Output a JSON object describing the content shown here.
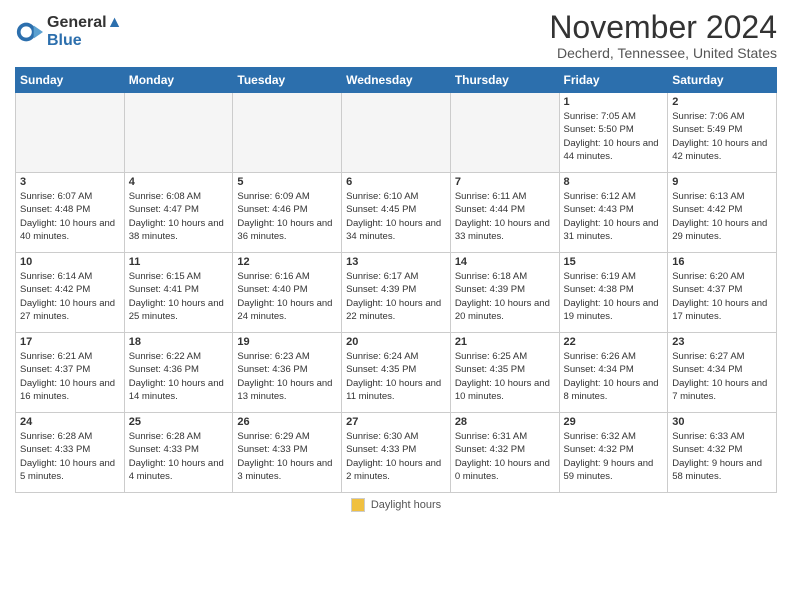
{
  "header": {
    "logo_line1": "General",
    "logo_line2": "Blue",
    "month": "November 2024",
    "location": "Decherd, Tennessee, United States"
  },
  "days_of_week": [
    "Sunday",
    "Monday",
    "Tuesday",
    "Wednesday",
    "Thursday",
    "Friday",
    "Saturday"
  ],
  "weeks": [
    [
      {
        "day": "",
        "info": ""
      },
      {
        "day": "",
        "info": ""
      },
      {
        "day": "",
        "info": ""
      },
      {
        "day": "",
        "info": ""
      },
      {
        "day": "",
        "info": ""
      },
      {
        "day": "1",
        "info": "Sunrise: 7:05 AM\nSunset: 5:50 PM\nDaylight: 10 hours and 44 minutes."
      },
      {
        "day": "2",
        "info": "Sunrise: 7:06 AM\nSunset: 5:49 PM\nDaylight: 10 hours and 42 minutes."
      }
    ],
    [
      {
        "day": "3",
        "info": "Sunrise: 6:07 AM\nSunset: 4:48 PM\nDaylight: 10 hours and 40 minutes."
      },
      {
        "day": "4",
        "info": "Sunrise: 6:08 AM\nSunset: 4:47 PM\nDaylight: 10 hours and 38 minutes."
      },
      {
        "day": "5",
        "info": "Sunrise: 6:09 AM\nSunset: 4:46 PM\nDaylight: 10 hours and 36 minutes."
      },
      {
        "day": "6",
        "info": "Sunrise: 6:10 AM\nSunset: 4:45 PM\nDaylight: 10 hours and 34 minutes."
      },
      {
        "day": "7",
        "info": "Sunrise: 6:11 AM\nSunset: 4:44 PM\nDaylight: 10 hours and 33 minutes."
      },
      {
        "day": "8",
        "info": "Sunrise: 6:12 AM\nSunset: 4:43 PM\nDaylight: 10 hours and 31 minutes."
      },
      {
        "day": "9",
        "info": "Sunrise: 6:13 AM\nSunset: 4:42 PM\nDaylight: 10 hours and 29 minutes."
      }
    ],
    [
      {
        "day": "10",
        "info": "Sunrise: 6:14 AM\nSunset: 4:42 PM\nDaylight: 10 hours and 27 minutes."
      },
      {
        "day": "11",
        "info": "Sunrise: 6:15 AM\nSunset: 4:41 PM\nDaylight: 10 hours and 25 minutes."
      },
      {
        "day": "12",
        "info": "Sunrise: 6:16 AM\nSunset: 4:40 PM\nDaylight: 10 hours and 24 minutes."
      },
      {
        "day": "13",
        "info": "Sunrise: 6:17 AM\nSunset: 4:39 PM\nDaylight: 10 hours and 22 minutes."
      },
      {
        "day": "14",
        "info": "Sunrise: 6:18 AM\nSunset: 4:39 PM\nDaylight: 10 hours and 20 minutes."
      },
      {
        "day": "15",
        "info": "Sunrise: 6:19 AM\nSunset: 4:38 PM\nDaylight: 10 hours and 19 minutes."
      },
      {
        "day": "16",
        "info": "Sunrise: 6:20 AM\nSunset: 4:37 PM\nDaylight: 10 hours and 17 minutes."
      }
    ],
    [
      {
        "day": "17",
        "info": "Sunrise: 6:21 AM\nSunset: 4:37 PM\nDaylight: 10 hours and 16 minutes."
      },
      {
        "day": "18",
        "info": "Sunrise: 6:22 AM\nSunset: 4:36 PM\nDaylight: 10 hours and 14 minutes."
      },
      {
        "day": "19",
        "info": "Sunrise: 6:23 AM\nSunset: 4:36 PM\nDaylight: 10 hours and 13 minutes."
      },
      {
        "day": "20",
        "info": "Sunrise: 6:24 AM\nSunset: 4:35 PM\nDaylight: 10 hours and 11 minutes."
      },
      {
        "day": "21",
        "info": "Sunrise: 6:25 AM\nSunset: 4:35 PM\nDaylight: 10 hours and 10 minutes."
      },
      {
        "day": "22",
        "info": "Sunrise: 6:26 AM\nSunset: 4:34 PM\nDaylight: 10 hours and 8 minutes."
      },
      {
        "day": "23",
        "info": "Sunrise: 6:27 AM\nSunset: 4:34 PM\nDaylight: 10 hours and 7 minutes."
      }
    ],
    [
      {
        "day": "24",
        "info": "Sunrise: 6:28 AM\nSunset: 4:33 PM\nDaylight: 10 hours and 5 minutes."
      },
      {
        "day": "25",
        "info": "Sunrise: 6:28 AM\nSunset: 4:33 PM\nDaylight: 10 hours and 4 minutes."
      },
      {
        "day": "26",
        "info": "Sunrise: 6:29 AM\nSunset: 4:33 PM\nDaylight: 10 hours and 3 minutes."
      },
      {
        "day": "27",
        "info": "Sunrise: 6:30 AM\nSunset: 4:33 PM\nDaylight: 10 hours and 2 minutes."
      },
      {
        "day": "28",
        "info": "Sunrise: 6:31 AM\nSunset: 4:32 PM\nDaylight: 10 hours and 0 minutes."
      },
      {
        "day": "29",
        "info": "Sunrise: 6:32 AM\nSunset: 4:32 PM\nDaylight: 9 hours and 59 minutes."
      },
      {
        "day": "30",
        "info": "Sunrise: 6:33 AM\nSunset: 4:32 PM\nDaylight: 9 hours and 58 minutes."
      }
    ]
  ],
  "legend": {
    "box_label": "Daylight hours"
  }
}
